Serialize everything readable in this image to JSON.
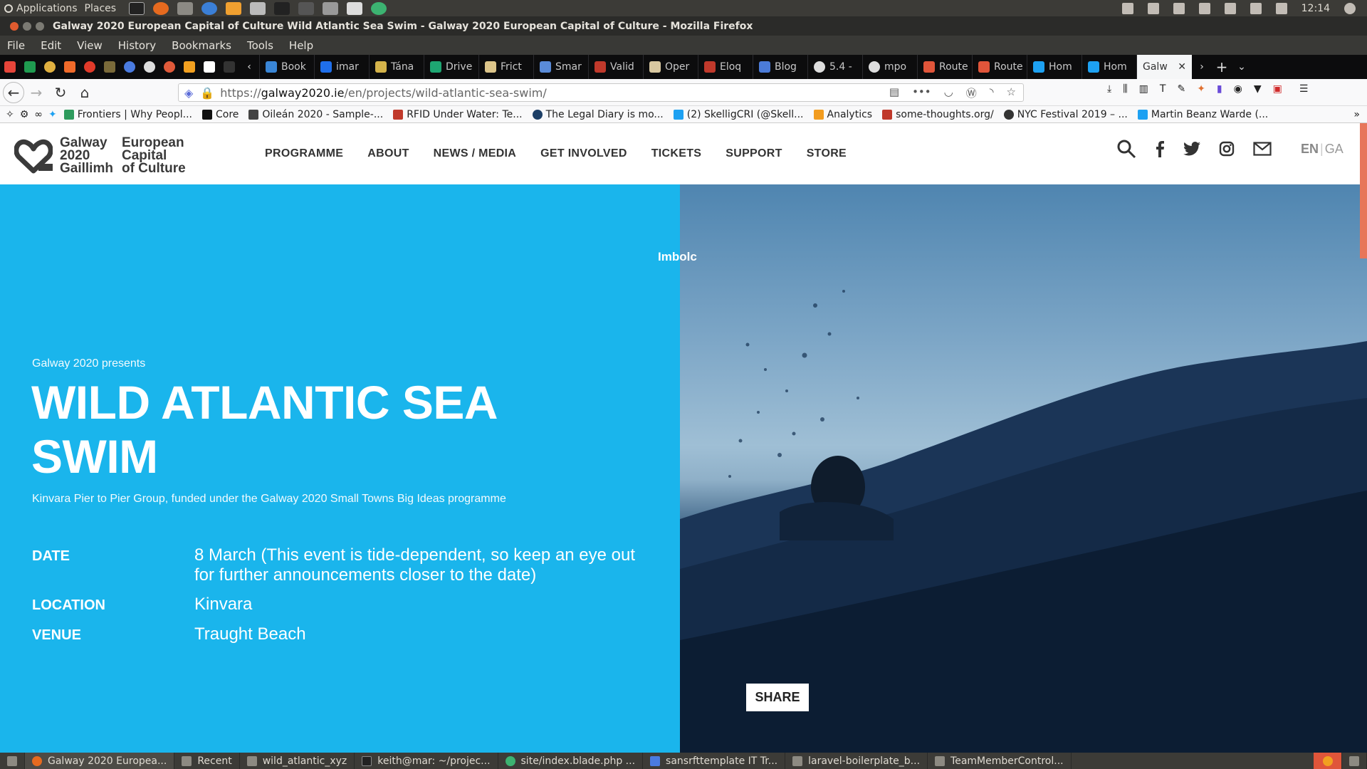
{
  "os_panel": {
    "applications": "Applications",
    "places": "Places",
    "clock": "12:14",
    "tray_icons": [
      "dropbox-icon",
      "files-icon",
      "updates-icon",
      "network-icon",
      "keyboard-icon",
      "mail-icon",
      "volume-icon"
    ],
    "launchers": [
      "terminal",
      "firefox",
      "files",
      "thunderbird",
      "settings",
      "screenshot",
      "inkscape",
      "git",
      "calculator",
      "editor",
      "app"
    ]
  },
  "window": {
    "title": "Galway 2020 European Capital of Culture Wild Atlantic Sea Swim - Galway 2020 European Capital of Culture - Mozilla Firefox"
  },
  "menubar": {
    "items": [
      "File",
      "Edit",
      "View",
      "History",
      "Bookmarks",
      "Tools",
      "Help"
    ]
  },
  "tabs": {
    "items": [
      {
        "label": "Book",
        "color": "#3a86d6"
      },
      {
        "label": "imar",
        "color": "#1f6feb"
      },
      {
        "label": "Tána",
        "color": "#d4b34a"
      },
      {
        "label": "Drive",
        "color": "#1ea672"
      },
      {
        "label": "Frict",
        "color": "#dcc58a"
      },
      {
        "label": "Smar",
        "color": "#5a8bd8"
      },
      {
        "label": "Valid",
        "color": "#c0392b"
      },
      {
        "label": "Oper",
        "color": "#d9c8a0"
      },
      {
        "label": "Eloq",
        "color": "#c0392b"
      },
      {
        "label": "Blog",
        "color": "#4b7bd8"
      },
      {
        "label": "5.4 -",
        "color": "#dddddd"
      },
      {
        "label": "mpo",
        "color": "#dddddd"
      },
      {
        "label": "Route",
        "color": "#e0553a"
      },
      {
        "label": "Route",
        "color": "#e0553a"
      },
      {
        "label": "Hom",
        "color": "#1da1f2"
      },
      {
        "label": "Hom",
        "color": "#1da1f2"
      }
    ],
    "active": "Galw"
  },
  "navbar": {
    "url_scheme": "https://",
    "url_host": "galway2020.ie",
    "url_path": "/en/projects/wild-atlantic-sea-swim/",
    "more": "•••"
  },
  "bookmarks": [
    {
      "label": "Frontiers | Why Peopl...",
      "color": "#2e9b5d"
    },
    {
      "label": "Core",
      "color": "#111111"
    },
    {
      "label": "Oileán 2020 - Sample-...",
      "color": "#444444"
    },
    {
      "label": "RFID Under Water: Te...",
      "color": "#c0392b"
    },
    {
      "label": "The Legal Diary is mo...",
      "color": "#1d3f66"
    },
    {
      "label": "(2) SkelligCRI (@Skell...",
      "color": "#1da1f2"
    },
    {
      "label": "Analytics",
      "color": "#f29c1f"
    },
    {
      "label": "some-thoughts.org/",
      "color": "#c0392b"
    },
    {
      "label": "NYC Festival 2019 – ...",
      "color": "#333333"
    },
    {
      "label": "Martin Beanz Warde (...",
      "color": "#1da1f2"
    }
  ],
  "site": {
    "logo": {
      "line1": "Galway",
      "line2": "2020",
      "line3": "Gaillimh",
      "line4": "European",
      "line5": "Capital",
      "line6": "of Culture"
    },
    "nav": [
      "PROGRAMME",
      "ABOUT",
      "NEWS / MEDIA",
      "GET INVOLVED",
      "TICKETS",
      "SUPPORT",
      "STORE"
    ],
    "lang_en": "EN",
    "lang_sep": "|",
    "lang_ga": "GA"
  },
  "hero": {
    "presents": "Galway 2020 presents",
    "title": "WILD ATLANTIC SEA SWIM",
    "subtitle": "Kinvara Pier to Pier Group, funded under the Galway 2020 Small Towns Big Ideas programme",
    "season": "Imbolc",
    "share": "SHARE",
    "details": {
      "date_label": "DATE",
      "date_value": "8 March (This event is tide-dependent, so keep an eye out for further announcements closer to the date)",
      "location_label": "LOCATION",
      "location_value": "Kinvara",
      "venue_label": "VENUE",
      "venue_value": "Traught Beach"
    },
    "colors": {
      "panel": "#1ab5ec"
    }
  },
  "taskbar": [
    "Galway 2020 Europea...",
    "Recent",
    "wild_atlantic_xyz",
    "keith@mar: ~/projec...",
    "site/index.blade.php ...",
    "sansrfttemplate IT Tr...",
    "laravel-boilerplate_b...",
    "TeamMemberControl..."
  ]
}
